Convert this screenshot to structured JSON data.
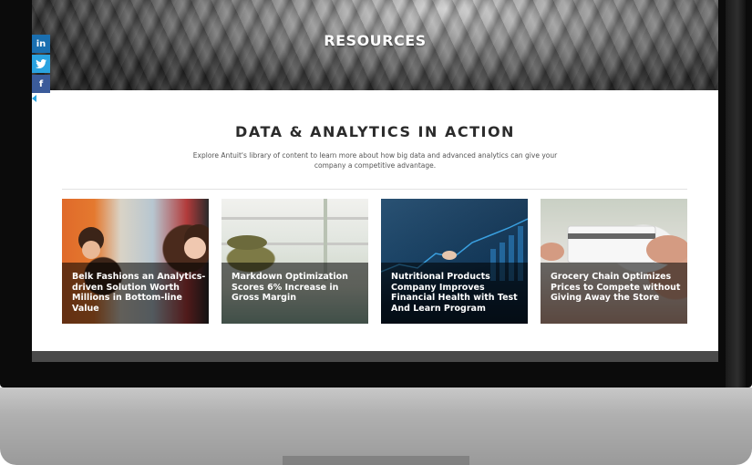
{
  "hero": {
    "title": "RESOURCES"
  },
  "social": [
    {
      "label": "in",
      "icon": "linkedin-icon",
      "color": "#1a6fb0"
    },
    {
      "label": "🐦",
      "icon": "twitter-icon",
      "color": "#2aa3e0"
    },
    {
      "label": "f",
      "icon": "facebook-icon",
      "color": "#3b5b9a"
    }
  ],
  "section": {
    "title": "DATA & ANALYTICS IN ACTION",
    "description": "Explore Antuit's library of content to learn more about how big data and advanced analytics can give your company a competitive advantage."
  },
  "cards": [
    {
      "title": "Belk Fashions an Analytics-driven Solution Worth Millions in Bottom-line Value"
    },
    {
      "title": "Markdown Optimization Scores 6% Increase in Gross Margin"
    },
    {
      "title": "Nutritional Products Company Improves Financial Health with Test And Learn Program"
    },
    {
      "title": "Grocery Chain Optimizes Prices to Compete without Giving Away the Store"
    }
  ]
}
